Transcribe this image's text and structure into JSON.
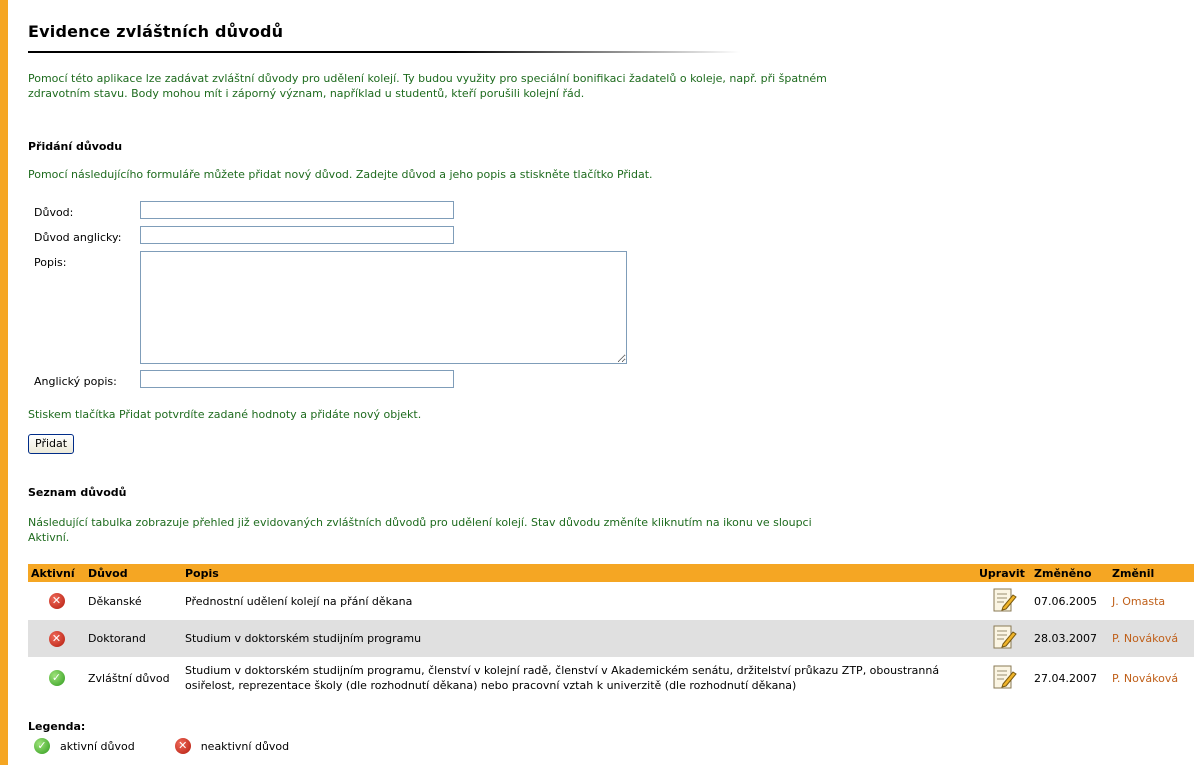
{
  "page": {
    "title": "Evidence zvláštních důvodů",
    "intro": "Pomocí této aplikace lze zadávat zvláštní důvody pro udělení kolejí. Ty budou využity pro speciální bonifikaci žadatelů o koleje, např. při špatném zdravotním stavu. Body mohou mít i záporný význam, například u studentů, kteří porušili kolejní řád."
  },
  "add_section": {
    "heading": "Přidání důvodu",
    "description": "Pomocí následujícího formuláře můžete přidat nový důvod. Zadejte důvod a jeho popis a stiskněte tlačítko Přidat.",
    "fields": {
      "reason_label": "Důvod:",
      "reason_value": "",
      "reason_en_label": "Důvod anglicky:",
      "reason_en_value": "",
      "description_label": "Popis:",
      "description_value": "",
      "description_en_label": "Anglický popis:",
      "description_en_value": ""
    },
    "confirm_text": "Stiskem tlačítka Přidat potvrdíte zadané hodnoty a přidáte nový objekt.",
    "add_button": "Přidat"
  },
  "list_section": {
    "heading": "Seznam důvodů",
    "description": "Následující tabulka zobrazuje přehled již evidovaných zvláštních důvodů pro udělení kolejí. Stav důvodu změníte kliknutím na ikonu ve sloupci Aktivní.",
    "columns": [
      "Aktivní",
      "Důvod",
      "Popis",
      "Upravit",
      "Změněno",
      "Změnil"
    ],
    "rows": [
      {
        "active": "inactive",
        "reason": "Děkanské",
        "description": "Přednostní udělení kolejí na přání děkana",
        "changed": "07.06.2005",
        "changed_by": "J. Omasta"
      },
      {
        "active": "inactive",
        "reason": "Doktorand",
        "description": "Studium v doktorském studijním programu",
        "changed": "28.03.2007",
        "changed_by": "P. Nováková"
      },
      {
        "active": "active",
        "reason": "Zvláštní důvod",
        "description": "Studium v doktorském studijním programu, členství v kolejní radě, členství v Akademickém senátu, držitelství průkazu ZTP, oboustranná osiřelost, reprezentace školy (dle rozhodnutí děkana) nebo pracovní vztah k univerzitě (dle rozhodnutí děkana)",
        "changed": "27.04.2007",
        "changed_by": "P. Nováková"
      }
    ]
  },
  "legend": {
    "title": "Legenda:",
    "active_label": "aktivní důvod",
    "inactive_label": "neaktivní důvod"
  },
  "colors": {
    "accent": "#f5a623",
    "text_green": "#1e6b1e",
    "link": "#c0601a",
    "row_alt": "#e0e0e0"
  }
}
